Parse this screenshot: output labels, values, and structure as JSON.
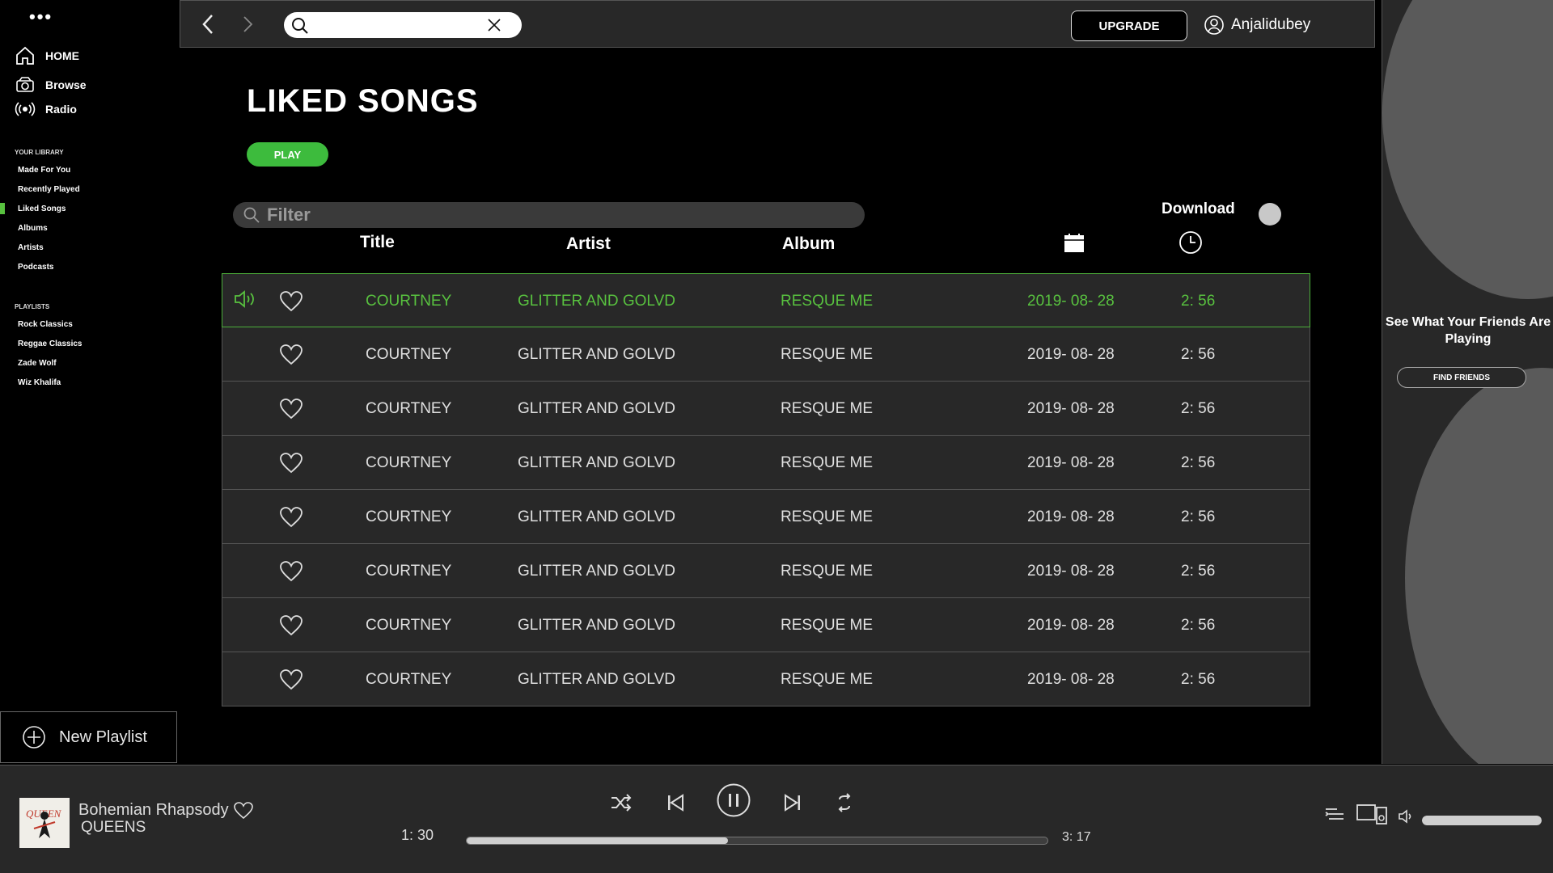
{
  "sidebar": {
    "nav": [
      {
        "label": "HOME",
        "icon": "home-icon"
      },
      {
        "label": "Browse",
        "icon": "browse-icon"
      },
      {
        "label": "Radio",
        "icon": "radio-icon"
      }
    ],
    "library_label": "YOUR LIBRARY",
    "library": [
      "Made For You",
      "Recently Played",
      "Liked Songs",
      "Albums",
      "Artists",
      "Podcasts"
    ],
    "active_library_item": "Liked Songs",
    "playlists_label": "PLAYLISTS",
    "playlists": [
      "Rock Classics",
      "Reggae Classics",
      "Zade Wolf",
      "Wiz Khalifa"
    ],
    "new_playlist_label": "New Playlist"
  },
  "topbar": {
    "search_value": "",
    "upgrade_label": "UPGRADE",
    "username": "Anjalidubey"
  },
  "main": {
    "title": "LIKED SONGS",
    "play_label": "PLAY",
    "filter_placeholder": "Filter",
    "download_label": "Download",
    "download_enabled": false,
    "columns": {
      "title": "Title",
      "artist": "Artist",
      "album": "Album",
      "date_icon": "calendar-icon",
      "duration_icon": "clock-icon"
    },
    "songs": [
      {
        "title": "COURTNEY",
        "artist": "GLITTER AND GOLVD",
        "album": "RESQUE ME",
        "date": "2019- 08- 28",
        "duration": "2: 56",
        "playing": true
      },
      {
        "title": "COURTNEY",
        "artist": "GLITTER AND GOLVD",
        "album": "RESQUE ME",
        "date": "2019- 08- 28",
        "duration": "2: 56",
        "playing": false
      },
      {
        "title": "COURTNEY",
        "artist": "GLITTER AND GOLVD",
        "album": "RESQUE ME",
        "date": "2019- 08- 28",
        "duration": "2: 56",
        "playing": false
      },
      {
        "title": "COURTNEY",
        "artist": "GLITTER AND GOLVD",
        "album": "RESQUE ME",
        "date": "2019- 08- 28",
        "duration": "2: 56",
        "playing": false
      },
      {
        "title": "COURTNEY",
        "artist": "GLITTER AND GOLVD",
        "album": "RESQUE ME",
        "date": "2019- 08- 28",
        "duration": "2: 56",
        "playing": false
      },
      {
        "title": "COURTNEY",
        "artist": "GLITTER AND GOLVD",
        "album": "RESQUE ME",
        "date": "2019- 08- 28",
        "duration": "2: 56",
        "playing": false
      },
      {
        "title": "COURTNEY",
        "artist": "GLITTER AND GOLVD",
        "album": "RESQUE ME",
        "date": "2019- 08- 28",
        "duration": "2: 56",
        "playing": false
      },
      {
        "title": "COURTNEY",
        "artist": "GLITTER AND GOLVD",
        "album": "RESQUE ME",
        "date": "2019- 08- 28",
        "duration": "2: 56",
        "playing": false
      }
    ]
  },
  "friends": {
    "text": "See What Your Friends Are Playing",
    "button_label": "FIND FRIENDS"
  },
  "player": {
    "track_title": "Bohemian Rhapsody",
    "track_artist": "QUEENS",
    "elapsed": "1: 30",
    "total": "3: 17",
    "progress_fraction": 0.45,
    "volume_fraction": 1.0,
    "album_art_text": "QUEEN"
  },
  "colors": {
    "accent_green": "#58c13f",
    "play_button_green": "#3dbb3d",
    "panel_gray": "#282828"
  }
}
